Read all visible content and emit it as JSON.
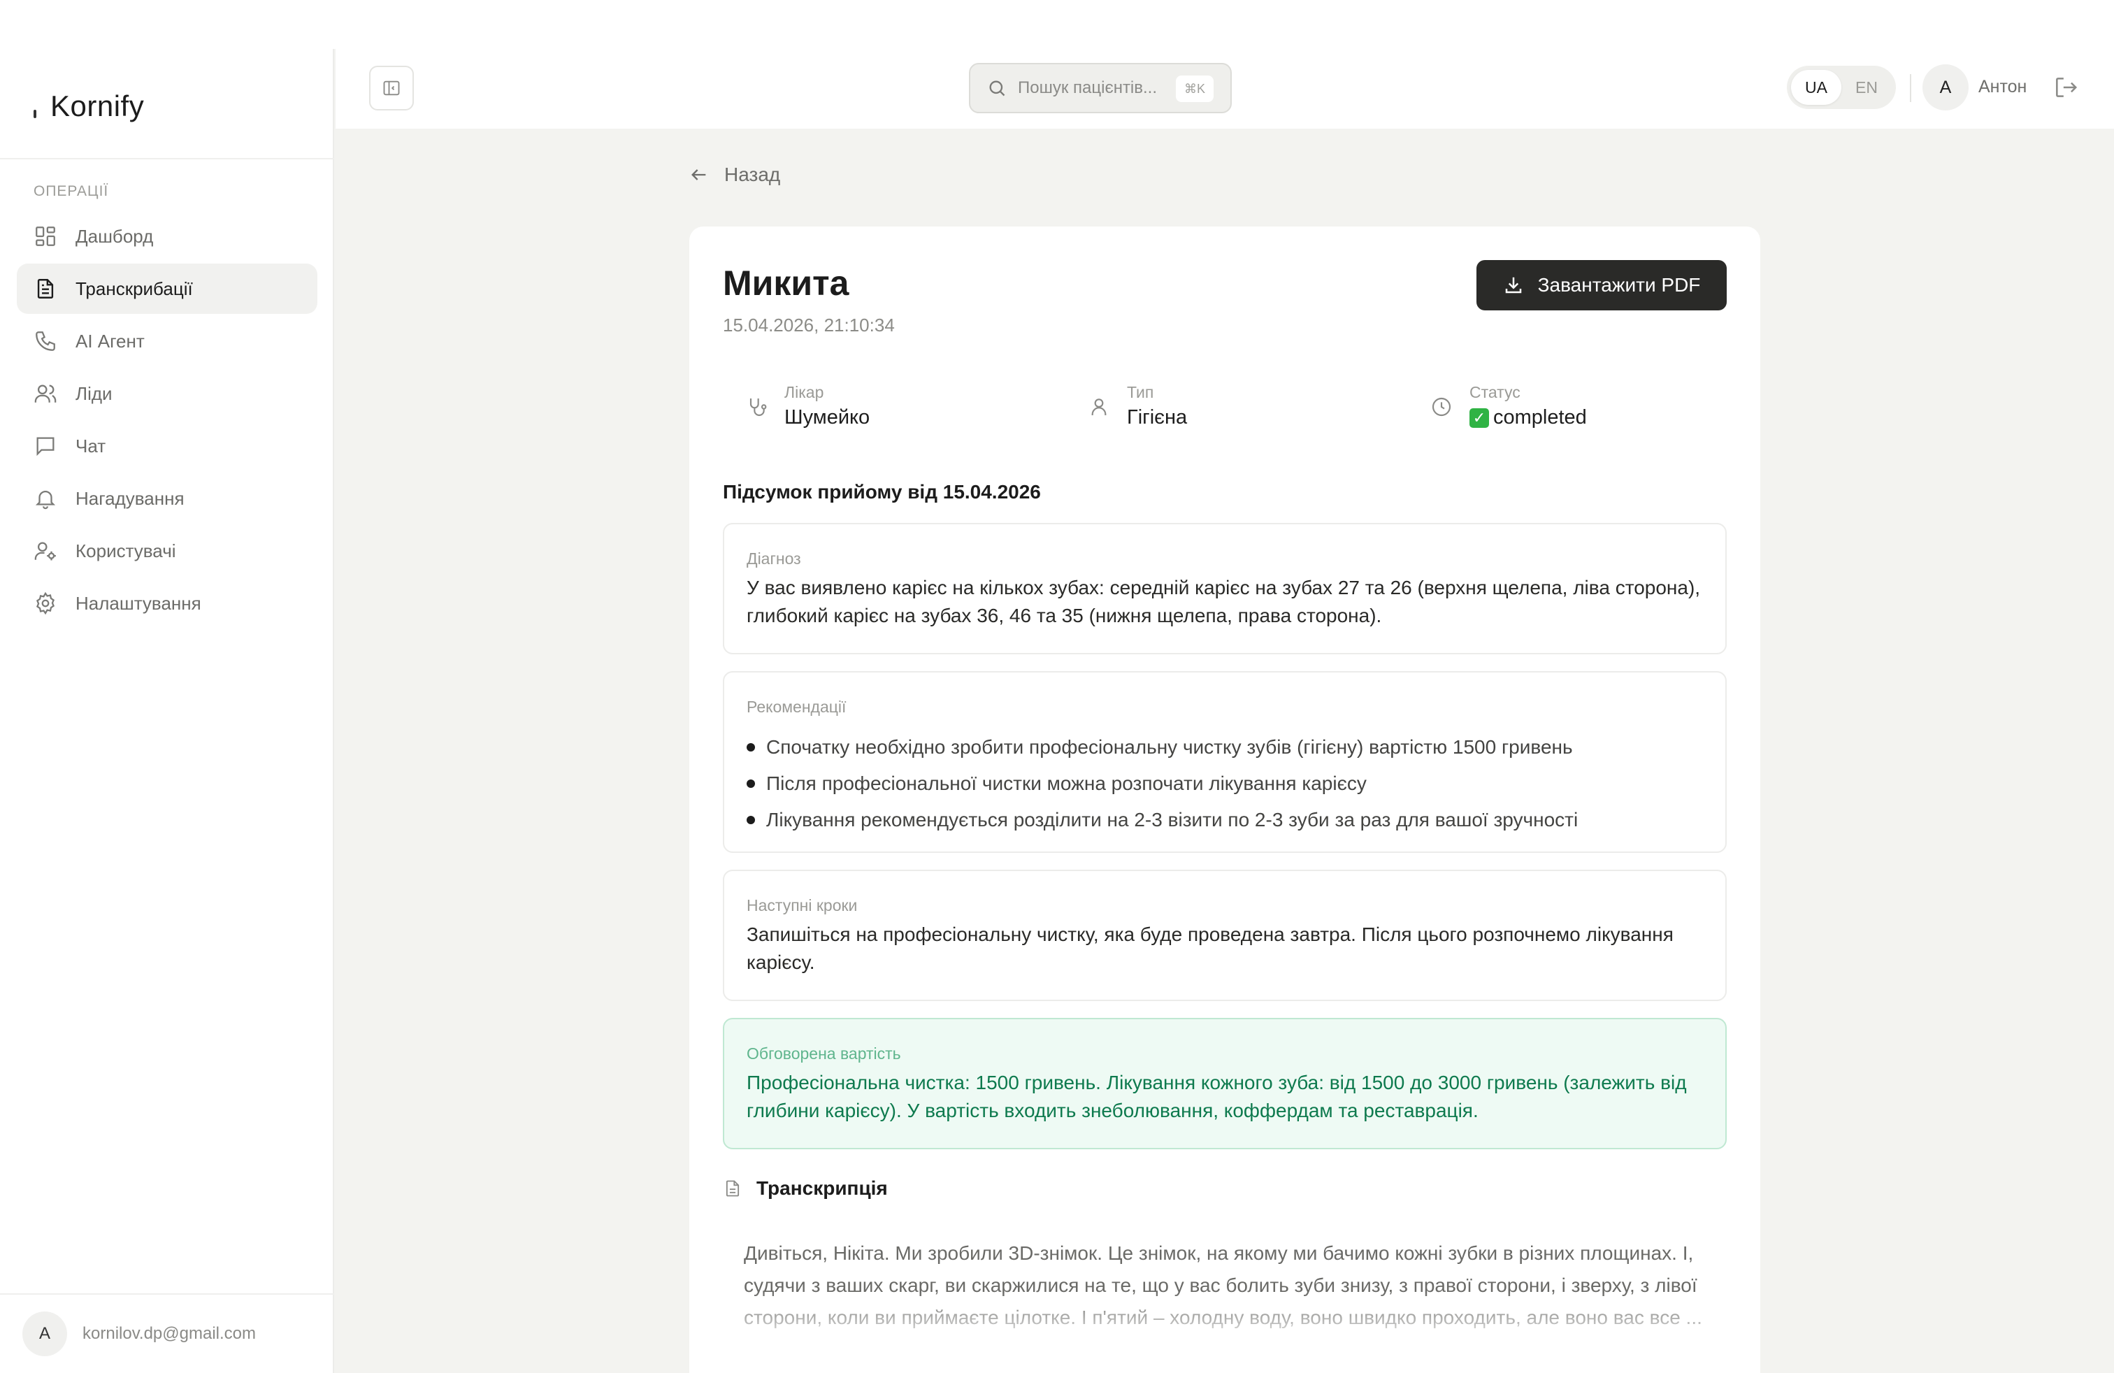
{
  "brand": {
    "name": "Kornify"
  },
  "sidebar": {
    "section": "ОПЕРАЦІЇ",
    "items": [
      {
        "label": "Дашборд",
        "icon": "dashboard-icon"
      },
      {
        "label": "Транскрибації",
        "icon": "document-icon",
        "active": true
      },
      {
        "label": "AI Агент",
        "icon": "phone-icon"
      },
      {
        "label": "Ліди",
        "icon": "users-icon"
      },
      {
        "label": "Чат",
        "icon": "chat-icon"
      },
      {
        "label": "Нагадування",
        "icon": "bell-icon"
      },
      {
        "label": "Користувачі",
        "icon": "user-settings-icon"
      },
      {
        "label": "Налаштування",
        "icon": "gear-icon"
      }
    ],
    "user": {
      "avatar": "A",
      "email": "kornilov.dp@gmail.com"
    }
  },
  "header": {
    "search_placeholder": "Пошук пацієнтів...",
    "search_shortcut": "⌘K",
    "lang_options": [
      "UA",
      "EN"
    ],
    "lang_active": "UA",
    "user_avatar": "A",
    "user_name": "Антон"
  },
  "main": {
    "back_label": "Назад",
    "patient_name": "Микита",
    "datetime": "15.04.2026, 21:10:34",
    "pdf_button": "Завантажити PDF",
    "meta": {
      "doctor_label": "Лікар",
      "doctor_value": "Шумейко",
      "type_label": "Тип",
      "type_value": "Гігієна",
      "status_label": "Статус",
      "status_value": "completed"
    },
    "summary_title": "Підсумок прийому від 15.04.2026",
    "diagnosis": {
      "label": "Діагноз",
      "text": "У вас виявлено карієс на кількох зубах: середній карієс на зубах 27 та 26 (верхня щелепа, ліва сторона), глибокий карієс на зубах 36, 46 та 35 (нижня щелепа, права сторона)."
    },
    "recommendations": {
      "label": "Рекомендації",
      "items": [
        "Спочатку необхідно зробити професіональну чистку зубів (гігієну) вартістю 1500 гривень",
        "Після професіональної чистки можна розпочати лікування карієсу",
        "Лікування рекомендується розділити на 2-3 візити по 2-3 зуби за раз для вашої зручності"
      ]
    },
    "next_steps": {
      "label": "Наступні кроки",
      "text": "Запишіться на професіональну чистку, яка буде проведена завтра. Після цього розпочнемо лікування карієсу."
    },
    "cost": {
      "label": "Обговорена вартість",
      "text": "Професіональна чистка: 1500 гривень. Лікування кожного зуба: від 1500 до 3000 гривень (залежить від глибини карієсу). У вартість входить знеболювання, коффердам та реставрація."
    },
    "transcript": {
      "title": "Транскрипція",
      "text": "Дивіться, Нікіта. Ми зробили 3D-знімок. Це знімок, на якому ми бачимо кожні зубки в різних площинах. І, судячи з ваших скарг, ви скаржилися на те, що у вас болить зуби знизу, з правої сторони, і зверху, з лівої сторони, коли ви приймаєте цілотке. І п'ятий – холодну воду, воно швидко проходить, але воно вас все ..."
    }
  },
  "colors": {
    "accent_dark": "#2a2a28",
    "success": "#2fb344",
    "cost_text": "#0e7a4e",
    "cost_bg": "#eefaf4"
  }
}
